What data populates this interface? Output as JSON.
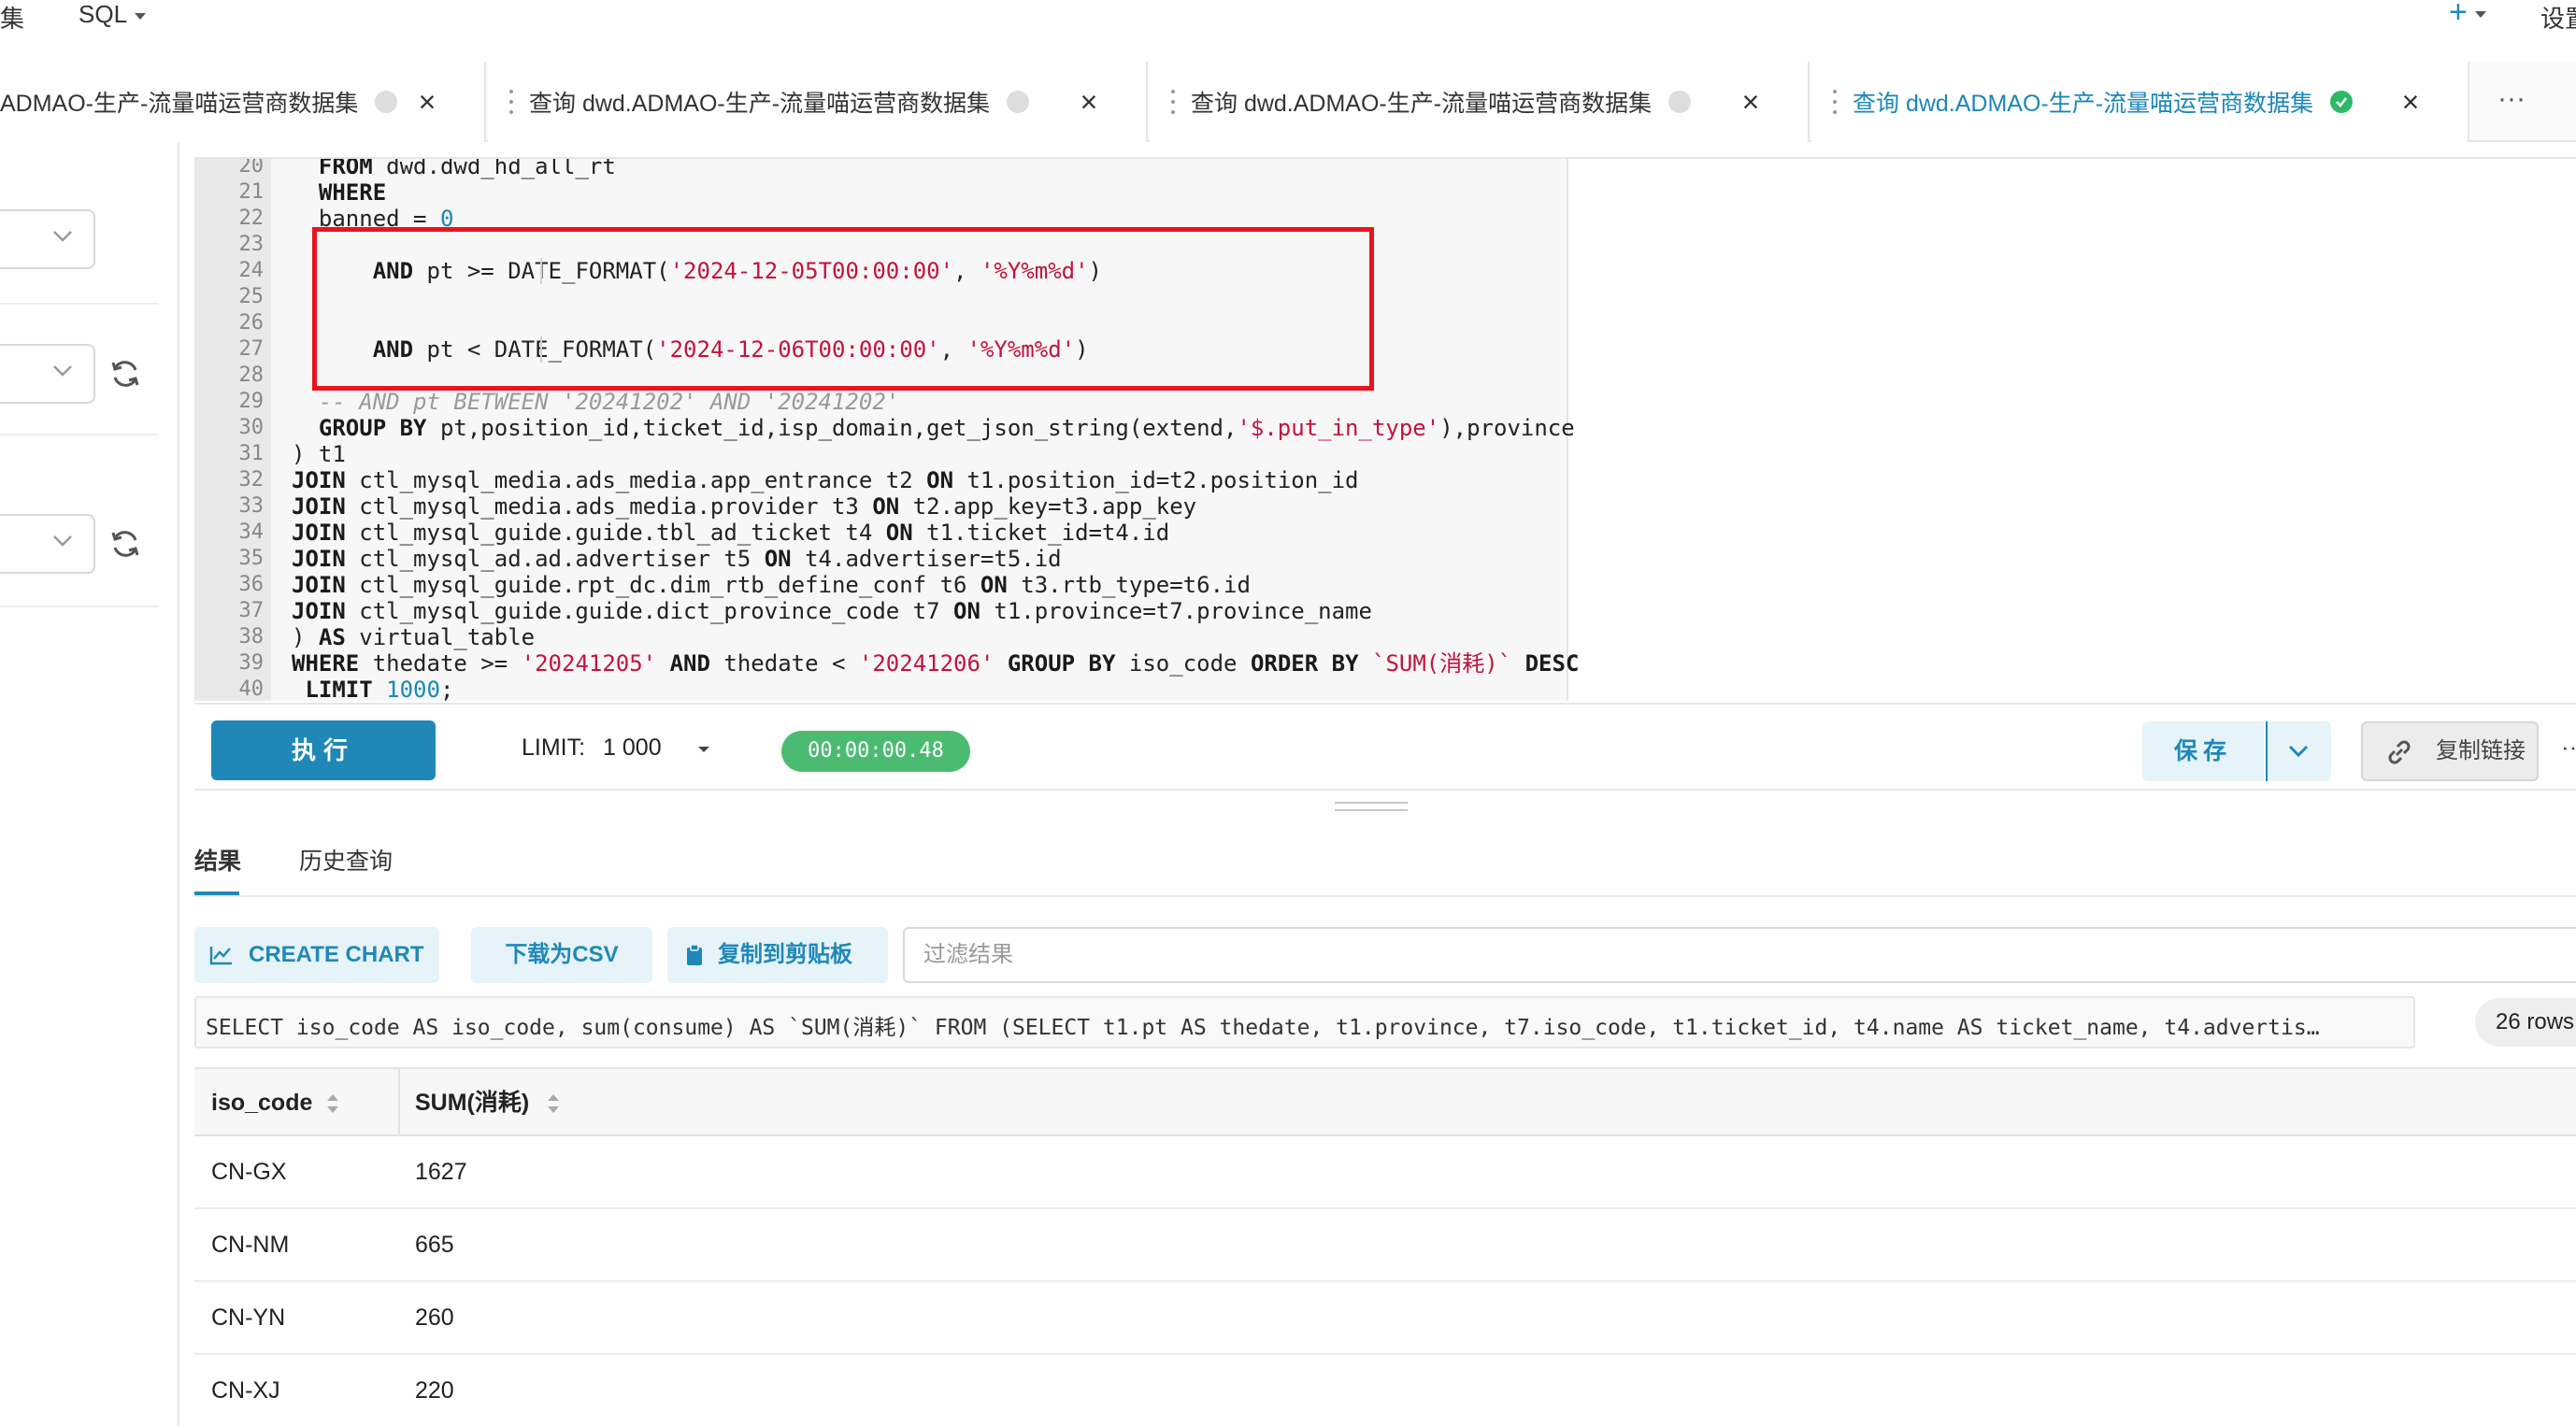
{
  "topbar": {
    "left_partial": "集",
    "sql_menu": "SQL",
    "plus": "+",
    "settings_partial": "设置"
  },
  "tabs": [
    {
      "title": "ADMAO-生产-流量喵运营商数据集",
      "close": "×"
    },
    {
      "title": "查询 dwd.ADMAO-生产-流量喵运营商数据集",
      "close": "×"
    },
    {
      "title": "查询 dwd.ADMAO-生产-流量喵运营商数据集",
      "close": "×"
    },
    {
      "title": "查询 dwd.ADMAO-生产-流量喵运营商数据集",
      "close": "×"
    }
  ],
  "tab_more": "···",
  "editor": {
    "line_numbers": [
      "20",
      "21",
      "22",
      "23",
      "24",
      "25",
      "26",
      "27",
      "28",
      "29",
      "30",
      "31",
      "32",
      "33",
      "34",
      "35",
      "36",
      "37",
      "38",
      "39",
      "40"
    ]
  },
  "toolbar": {
    "run_label": "执行",
    "limit_label": "LIMIT:",
    "limit_value": "1 000",
    "timer": "00:00:00.48",
    "save_label": "保存",
    "copy_link_label": "复制链接",
    "more": "··"
  },
  "results": {
    "tab_results": "结果",
    "tab_history": "历史查询",
    "create_chart": "CREATE CHART",
    "download_csv": "下载为CSV",
    "copy_clipboard": "复制到剪贴板",
    "filter_placeholder": "过滤结果",
    "sql_preview": "SELECT iso_code AS iso_code, sum(consume) AS `SUM(消耗)` FROM (SELECT t1.pt AS thedate, t1.province, t7.iso_code, t1.ticket_id, t4.name AS ticket_name, t4.advertis…",
    "rows_count": "26 rows",
    "columns": [
      "iso_code",
      "SUM(消耗)"
    ],
    "rows": [
      [
        "CN-GX",
        "1627"
      ],
      [
        "CN-NM",
        "665"
      ],
      [
        "CN-YN",
        "260"
      ],
      [
        "CN-XJ",
        "220"
      ]
    ]
  },
  "colors": {
    "accent": "#1f88b8",
    "success": "#2dba66",
    "highlight": "#e8141e",
    "string": "#c4123e"
  }
}
